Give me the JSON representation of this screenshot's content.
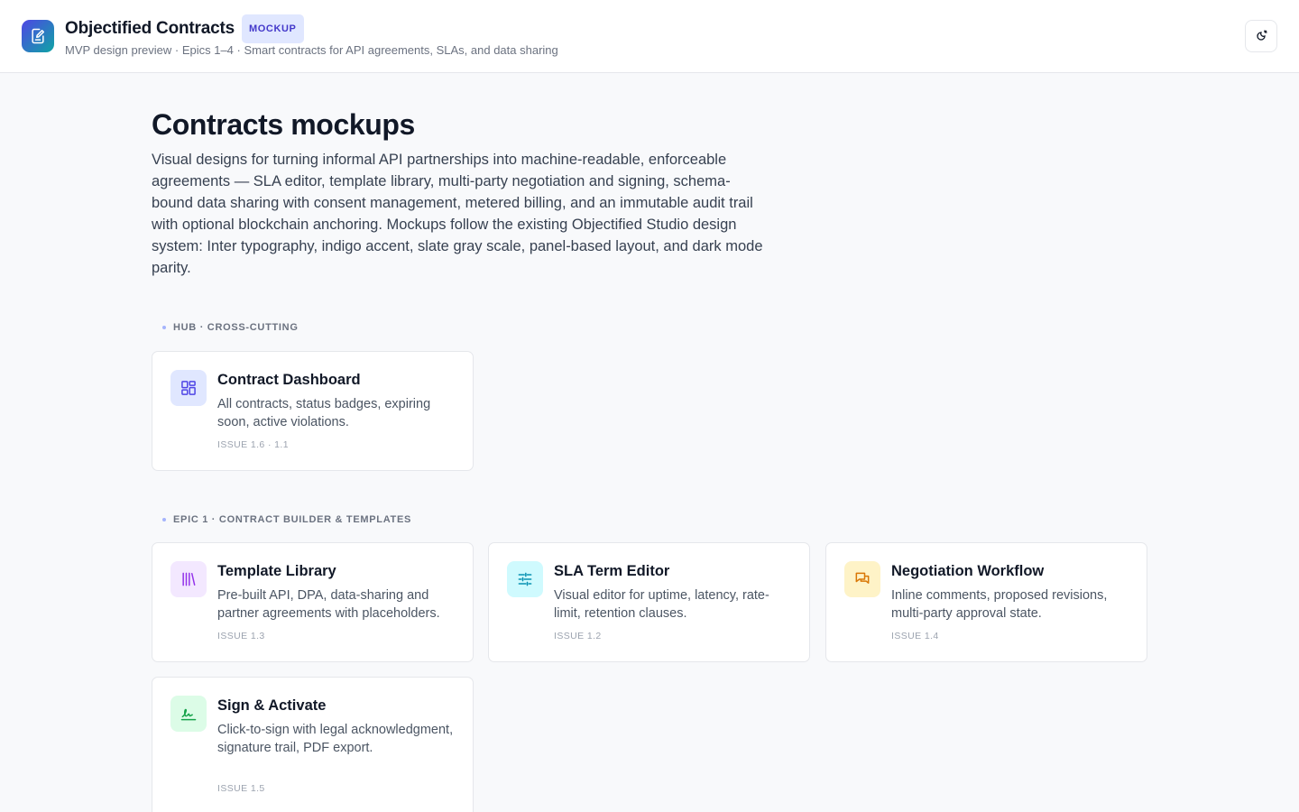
{
  "header": {
    "title": "Objectified Contracts",
    "badge": "MOCKUP",
    "subtitle": "MVP design preview · Epics 1–4 · Smart contracts for API agreements, SLAs, and data sharing",
    "logo_icon": "contract-edit-icon",
    "theme_toggle_icon": "theme-toggle-icon"
  },
  "main": {
    "title": "Contracts mockups",
    "description": "Visual designs for turning informal API partnerships into machine-readable, enforceable agreements — SLA editor, template library, multi-party negotiation and signing, schema-bound data sharing with consent management, metered billing, and an immutable audit trail with optional blockchain anchoring. Mockups follow the existing Objectified Studio design system: Inter typography, indigo accent, slate gray scale, panel-based layout, and dark mode parity."
  },
  "sections": [
    {
      "label": "HUB · CROSS-CUTTING",
      "cards": [
        {
          "title": "Contract Dashboard",
          "description": "All contracts, status badges, expiring soon, active violations.",
          "issue": "ISSUE 1.6 · 1.1",
          "icon": "dashboard-icon",
          "icon_bg": "#e0e7ff",
          "icon_color": "#4f46e5"
        }
      ]
    },
    {
      "label": "EPIC 1 · CONTRACT BUILDER & TEMPLATES",
      "cards": [
        {
          "title": "Template Library",
          "description": "Pre-built API, DPA, data-sharing and partner agreements with placeholders.",
          "issue": "ISSUE 1.3",
          "icon": "library-icon",
          "icon_bg": "#f3e8ff",
          "icon_color": "#9333ea"
        },
        {
          "title": "SLA Term Editor",
          "description": "Visual editor for uptime, latency, rate-limit, retention clauses.",
          "issue": "ISSUE 1.2",
          "icon": "sliders-icon",
          "icon_bg": "#cffafe",
          "icon_color": "#0891b2"
        },
        {
          "title": "Negotiation Workflow",
          "description": "Inline comments, proposed revisions, multi-party approval state.",
          "issue": "ISSUE 1.4",
          "icon": "chat-icon",
          "icon_bg": "#fef3c7",
          "icon_color": "#d97706"
        },
        {
          "title": "Sign & Activate",
          "description": "Click-to-sign with legal acknowledgment, signature trail, PDF export.",
          "issue": "ISSUE 1.5",
          "icon": "signature-icon",
          "icon_bg": "#dcfce7",
          "icon_color": "#16a34a"
        }
      ]
    }
  ]
}
